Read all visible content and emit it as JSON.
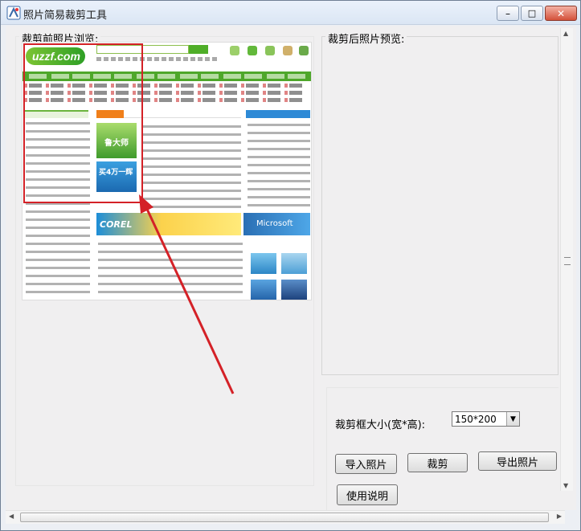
{
  "window": {
    "title": "照片简易裁剪工具",
    "controls": {
      "minimize": "–",
      "maximize": "□",
      "close": "✕"
    }
  },
  "before_panel": {
    "label": "裁剪前照片浏览:",
    "image": {
      "logo": "uzzf.com",
      "banner_left": "COREL",
      "banner_right": "Microsoft",
      "ad_top": "鲁大师",
      "ad_bottom": "买4万一辉"
    }
  },
  "after_panel": {
    "label": "裁剪后照片预览:"
  },
  "controls": {
    "crop_size_label": "裁剪框大小(宽*高):",
    "crop_size_value": "150*200",
    "import_button": "导入照片",
    "crop_button": "裁剪",
    "export_button": "导出照片",
    "help_button": "使用说明"
  },
  "colors": {
    "crop_rect": "#d42127",
    "arrow": "#d42127"
  },
  "icons": {
    "app": "app-icon",
    "dropdown": "chevron-down-icon"
  }
}
